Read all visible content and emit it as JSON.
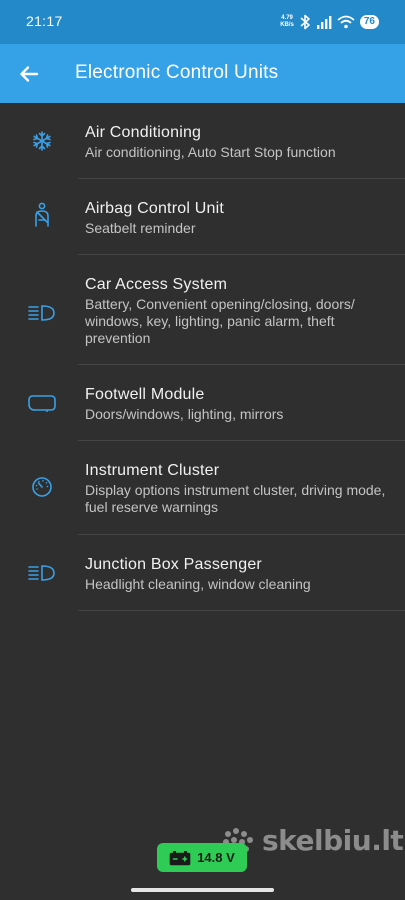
{
  "status_bar": {
    "time": "21:17",
    "net_speed_value": "4.79",
    "net_speed_unit": "KB/s",
    "battery": "76"
  },
  "app_bar": {
    "title": "Electronic Control Units"
  },
  "items": [
    {
      "title": "Air Conditioning",
      "subtitle": "Air conditioning, Auto Start Stop function",
      "icon": "snowflake-icon"
    },
    {
      "title": "Airbag Control Unit",
      "subtitle": "Seatbelt reminder",
      "icon": "seatbelt-icon"
    },
    {
      "title": "Car Access System",
      "subtitle": "Battery, Convenient opening/closing, doors/ windows, key, lighting, panic alarm, theft prevention",
      "icon": "headlight-icon"
    },
    {
      "title": "Footwell Module",
      "subtitle": "Doors/windows, lighting, mirrors",
      "icon": "mirror-icon"
    },
    {
      "title": "Instrument Cluster",
      "subtitle": "Display options instrument cluster, driving mode, fuel reserve warnings",
      "icon": "gauge-icon"
    },
    {
      "title": "Junction Box Passenger",
      "subtitle": "Headlight cleaning, window cleaning",
      "icon": "headlight-icon"
    }
  ],
  "voltage": {
    "value": "14.8 V"
  },
  "watermark": {
    "text": "skelbiu.lt"
  },
  "colors": {
    "status_bar": "#2489c9",
    "app_bar": "#35a2e8",
    "background": "#2f2f2f",
    "accent_icon": "#3aa0e6",
    "voltage_badge": "#2ecc55"
  }
}
